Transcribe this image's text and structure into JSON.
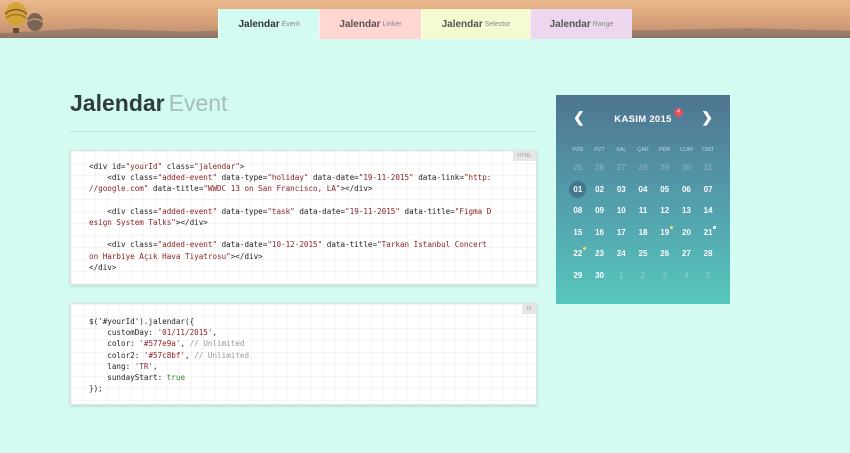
{
  "tabs": [
    {
      "name": "Jalendar",
      "sub": "Event"
    },
    {
      "name": "Jalendar",
      "sub": "Linker"
    },
    {
      "name": "Jalendar",
      "sub": "Selector"
    },
    {
      "name": "Jalendar",
      "sub": "Range"
    }
  ],
  "page": {
    "title": "Jalendar",
    "subtitle": "Event"
  },
  "html_box": {
    "badge": "HTML",
    "lines": [
      [
        {
          "t": "<div id=",
          "c": "attr"
        },
        {
          "t": "\"yourId\"",
          "c": "str"
        },
        {
          "t": " class=",
          "c": "attr"
        },
        {
          "t": "\"jalendar\"",
          "c": "str"
        },
        {
          "t": ">",
          "c": "attr"
        }
      ],
      [
        {
          "t": "    <div class=",
          "c": "attr"
        },
        {
          "t": "\"added-event\"",
          "c": "str"
        },
        {
          "t": " data-type=",
          "c": "attr"
        },
        {
          "t": "\"holiday\"",
          "c": "str"
        },
        {
          "t": " data-date=",
          "c": "attr"
        },
        {
          "t": "\"19-11-2015\"",
          "c": "str"
        },
        {
          "t": " data-link=",
          "c": "attr"
        },
        {
          "t": "\"http:",
          "c": "str"
        }
      ],
      [
        {
          "t": "//google.com\"",
          "c": "str"
        },
        {
          "t": " data-title=",
          "c": "attr"
        },
        {
          "t": "\"WWDC 13 on San Francisco, LA\"",
          "c": "str"
        },
        {
          "t": "></div>",
          "c": "attr"
        }
      ],
      [
        {
          "t": "",
          "c": "attr"
        }
      ],
      [
        {
          "t": "    <div class=",
          "c": "attr"
        },
        {
          "t": "\"added-event\"",
          "c": "str"
        },
        {
          "t": " data-type=",
          "c": "attr"
        },
        {
          "t": "\"task\"",
          "c": "str"
        },
        {
          "t": " data-date=",
          "c": "attr"
        },
        {
          "t": "\"19-11-2015\"",
          "c": "str"
        },
        {
          "t": " data-title=",
          "c": "attr"
        },
        {
          "t": "\"Figma D",
          "c": "str"
        }
      ],
      [
        {
          "t": "esign System Talks\"",
          "c": "str"
        },
        {
          "t": "></div>",
          "c": "attr"
        }
      ],
      [
        {
          "t": "",
          "c": "attr"
        }
      ],
      [
        {
          "t": "    <div class=",
          "c": "attr"
        },
        {
          "t": "\"added-event\"",
          "c": "str"
        },
        {
          "t": " data-date=",
          "c": "attr"
        },
        {
          "t": "\"10-12-2015\"",
          "c": "str"
        },
        {
          "t": " data-title=",
          "c": "attr"
        },
        {
          "t": "\"Tarkan İstanbul Concert",
          "c": "str"
        }
      ],
      [
        {
          "t": "on Harbiye Açık Hava Tiyatrosu\"",
          "c": "str"
        },
        {
          "t": "></div>",
          "c": "attr"
        }
      ],
      [
        {
          "t": "</div>",
          "c": "attr"
        }
      ]
    ]
  },
  "js_box": {
    "badge": "JS",
    "lines": [
      [
        {
          "t": "$('#yourId').jalendar({",
          "c": "attr"
        }
      ],
      [
        {
          "t": "    customDay: ",
          "c": "attr"
        },
        {
          "t": "'01/11/2015'",
          "c": "str"
        },
        {
          "t": ",",
          "c": "attr"
        }
      ],
      [
        {
          "t": "    color: ",
          "c": "attr"
        },
        {
          "t": "'#577e9a'",
          "c": "str"
        },
        {
          "t": ", ",
          "c": "attr"
        },
        {
          "t": "// Unlimited",
          "c": "cmt"
        }
      ],
      [
        {
          "t": "    color2: ",
          "c": "attr"
        },
        {
          "t": "'#57c8bf'",
          "c": "str"
        },
        {
          "t": ", ",
          "c": "attr"
        },
        {
          "t": "// Unlimited",
          "c": "cmt"
        }
      ],
      [
        {
          "t": "    lang: ",
          "c": "attr"
        },
        {
          "t": "'TR'",
          "c": "str"
        },
        {
          "t": ",",
          "c": "attr"
        }
      ],
      [
        {
          "t": "    sundayStart: ",
          "c": "attr"
        },
        {
          "t": "true",
          "c": "kw"
        }
      ],
      [
        {
          "t": "});",
          "c": "attr"
        }
      ]
    ]
  },
  "calendar": {
    "month": "KASIM 2015",
    "event_count": "4",
    "prev_icon": "chevron-left-icon",
    "next_icon": "chevron-right-icon",
    "weekdays": [
      "PZR",
      "PZT",
      "SAL",
      "ÇAR",
      "PER",
      "CUM",
      "CMT"
    ],
    "days": [
      {
        "d": "25",
        "o": true
      },
      {
        "d": "26",
        "o": true
      },
      {
        "d": "27",
        "o": true
      },
      {
        "d": "28",
        "o": true
      },
      {
        "d": "29",
        "o": true
      },
      {
        "d": "30",
        "o": true
      },
      {
        "d": "31",
        "o": true
      },
      {
        "d": "01",
        "today": true
      },
      {
        "d": "02"
      },
      {
        "d": "03"
      },
      {
        "d": "04"
      },
      {
        "d": "05"
      },
      {
        "d": "06"
      },
      {
        "d": "07"
      },
      {
        "d": "08"
      },
      {
        "d": "09"
      },
      {
        "d": "10"
      },
      {
        "d": "11"
      },
      {
        "d": "12"
      },
      {
        "d": "13"
      },
      {
        "d": "14"
      },
      {
        "d": "15"
      },
      {
        "d": "16"
      },
      {
        "d": "17"
      },
      {
        "d": "18"
      },
      {
        "d": "19",
        "dot": "#f4e46b"
      },
      {
        "d": "20"
      },
      {
        "d": "21",
        "dot": "#ffffff"
      },
      {
        "d": "22",
        "dot": "#f4e46b"
      },
      {
        "d": "23"
      },
      {
        "d": "24"
      },
      {
        "d": "25"
      },
      {
        "d": "26"
      },
      {
        "d": "27"
      },
      {
        "d": "28"
      },
      {
        "d": "29"
      },
      {
        "d": "30"
      },
      {
        "d": "1",
        "o": true
      },
      {
        "d": "2",
        "o": true
      },
      {
        "d": "3",
        "o": true
      },
      {
        "d": "4",
        "o": true
      },
      {
        "d": "5",
        "o": true
      }
    ]
  },
  "colors": {
    "accent": "#577e9a",
    "accent2": "#57c8bf",
    "background": "#d3fbf2",
    "event_badge": "#e64f5f"
  }
}
